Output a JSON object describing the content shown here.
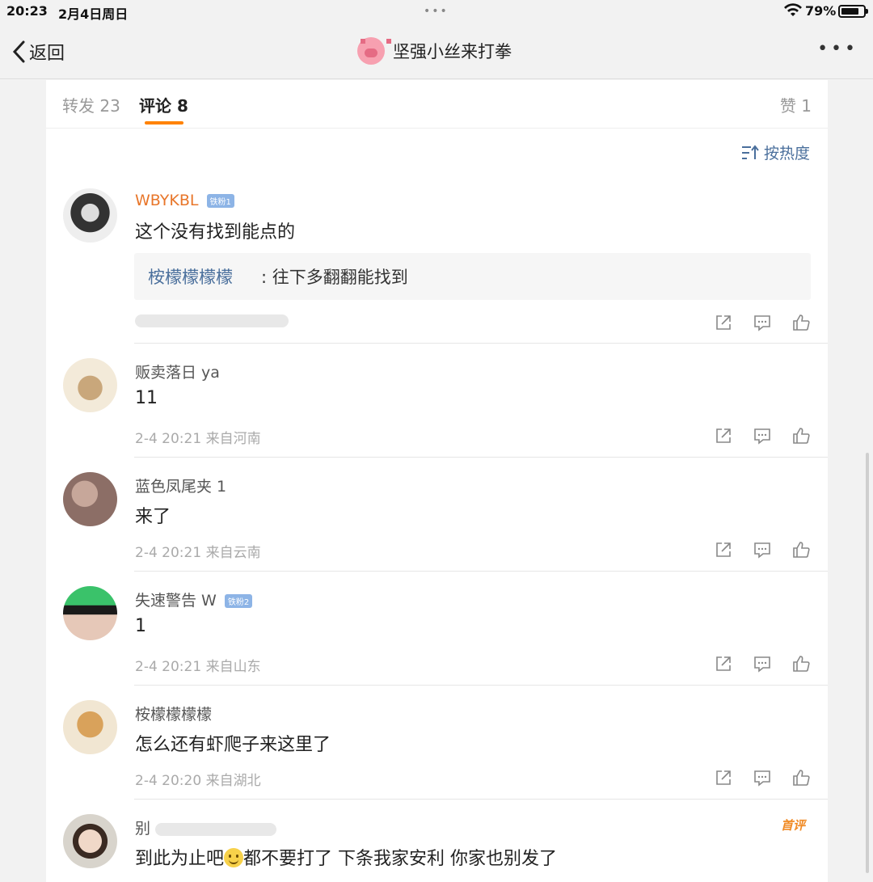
{
  "status_bar": {
    "time": "20:23",
    "date": "2月4日周日",
    "dots": "•••",
    "battery": "79%"
  },
  "nav": {
    "back_label": "返回",
    "title": "坚强小丝来打拳",
    "more": "•••"
  },
  "tabs": {
    "repost": "转发 23",
    "comment": "评论 8",
    "like": "赞 1"
  },
  "sort_label": "按热度",
  "comments": [
    {
      "user": "WBYKBL",
      "badge": "铁粉1",
      "text": "这个没有找到能点的",
      "reply_name": "桉檬檬檬檬",
      "reply_text": ": 往下多翻翻能找到",
      "meta": ""
    },
    {
      "user": "贩卖落日 ya",
      "text": "11",
      "meta": "2-4 20:21 来自河南"
    },
    {
      "user": "蓝色凤尾夹 1",
      "text": "来了",
      "meta": "2-4 20:21 来自云南"
    },
    {
      "user": "失速警告 W",
      "badge": "铁粉2",
      "text": "1",
      "meta": "2-4 20:21 来自山东"
    },
    {
      "user": "桉檬檬檬檬",
      "text": "怎么还有虾爬子来这里了",
      "meta": "2-4 20:20 来自湖北"
    },
    {
      "user": "别",
      "text_a": "到此为止吧",
      "text_b": "都不要打了  下条我家安利 你家也别发了",
      "tag": "首评"
    }
  ],
  "icons": [
    "back-chevron-icon",
    "wifi-icon",
    "battery-icon",
    "sort-icon",
    "share-icon",
    "comment-icon",
    "like-icon"
  ]
}
